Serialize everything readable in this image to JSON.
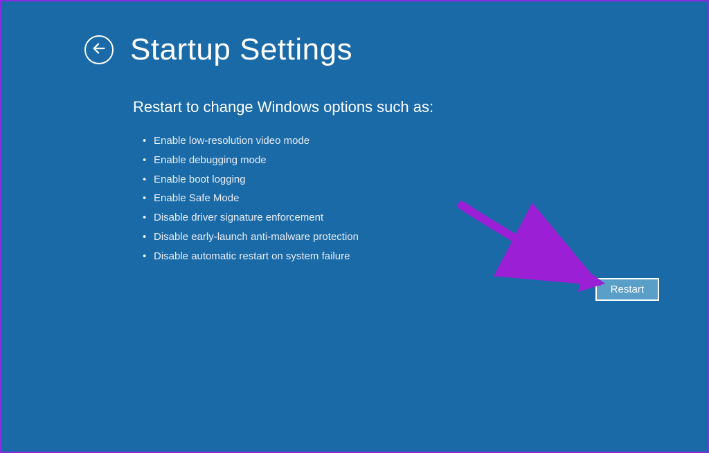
{
  "header": {
    "title": "Startup Settings"
  },
  "content": {
    "subtitle": "Restart to change Windows options such as:",
    "options": [
      "Enable low-resolution video mode",
      "Enable debugging mode",
      "Enable boot logging",
      "Enable Safe Mode",
      "Disable driver signature enforcement",
      "Disable early-launch anti-malware protection",
      "Disable automatic restart on system failure"
    ]
  },
  "action": {
    "restart_label": "Restart"
  },
  "colors": {
    "background": "#1a6aa8",
    "button_bg": "#5a9fc8",
    "annotation": "#9b1fd4"
  }
}
